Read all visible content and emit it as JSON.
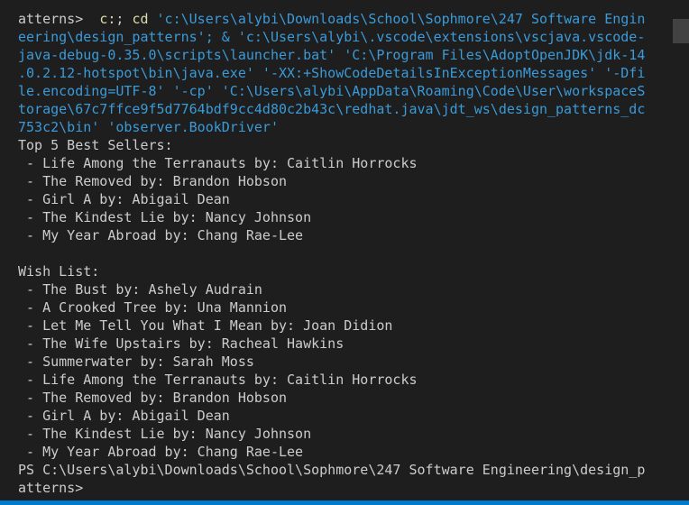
{
  "terminal": {
    "command_lines": [
      {
        "prompt": "atterns>  ",
        "cmd": "c:",
        "sep": "; ",
        "cd": "cd",
        "rest": " 'c:\\Users\\alybi\\Downloads\\School\\Sophmore\\247 Software Engin"
      },
      {
        "text": "eering\\design_patterns'; & 'c:\\Users\\alybi\\.vscode\\extensions\\vscjava.vscode-"
      },
      {
        "text": "java-debug-0.35.0\\scripts\\launcher.bat' 'C:\\Program Files\\AdoptOpenJDK\\jdk-14"
      },
      {
        "text": ".0.2.12-hotspot\\bin\\java.exe' '-XX:+ShowCodeDetailsInExceptionMessages' '-Dfi"
      },
      {
        "text": "le.encoding=UTF-8' '-cp' 'C:\\Users\\alybi\\AppData\\Roaming\\Code\\User\\workspaceS"
      },
      {
        "text": "torage\\67c7ffce9f5d7764bdf9cc4d80c2b43c\\redhat.java\\jdt_ws\\design_patterns_dc"
      },
      {
        "text": "753c2\\bin' 'observer.BookDriver'"
      }
    ],
    "best_sellers": {
      "heading": "Top 5 Best Sellers:",
      "items": [
        " - Life Among the Terranauts by: Caitlin Horrocks",
        " - The Removed by: Brandon Hobson",
        " - Girl A by: Abigail Dean",
        " - The Kindest Lie by: Nancy Johnson",
        " - My Year Abroad by: Chang Rae-Lee"
      ]
    },
    "wish_list": {
      "heading": "Wish List:",
      "items": [
        " - The Bust by: Ashely Audrain",
        " - A Crooked Tree by: Una Mannion",
        " - Let Me Tell You What I Mean by: Joan Didion",
        " - The Wife Upstairs by: Racheal Hawkins",
        " - Summerwater by: Sarah Moss",
        " - Life Among the Terranauts by: Caitlin Horrocks",
        " - The Removed by: Brandon Hobson",
        " - Girl A by: Abigail Dean",
        " - The Kindest Lie by: Nancy Johnson",
        " - My Year Abroad by: Chang Rae-Lee"
      ]
    },
    "final_prompt": [
      "PS C:\\Users\\alybi\\Downloads\\School\\Sophmore\\247 Software Engineering\\design_p",
      "atterns>"
    ]
  },
  "colors": {
    "background": "#1e1e1e",
    "text": "#cccccc",
    "command_path": "#3b9ad8",
    "command_keyword": "#dcdcaa",
    "accent_strip": "#007acc",
    "scrollbar_thumb": "#424242"
  }
}
